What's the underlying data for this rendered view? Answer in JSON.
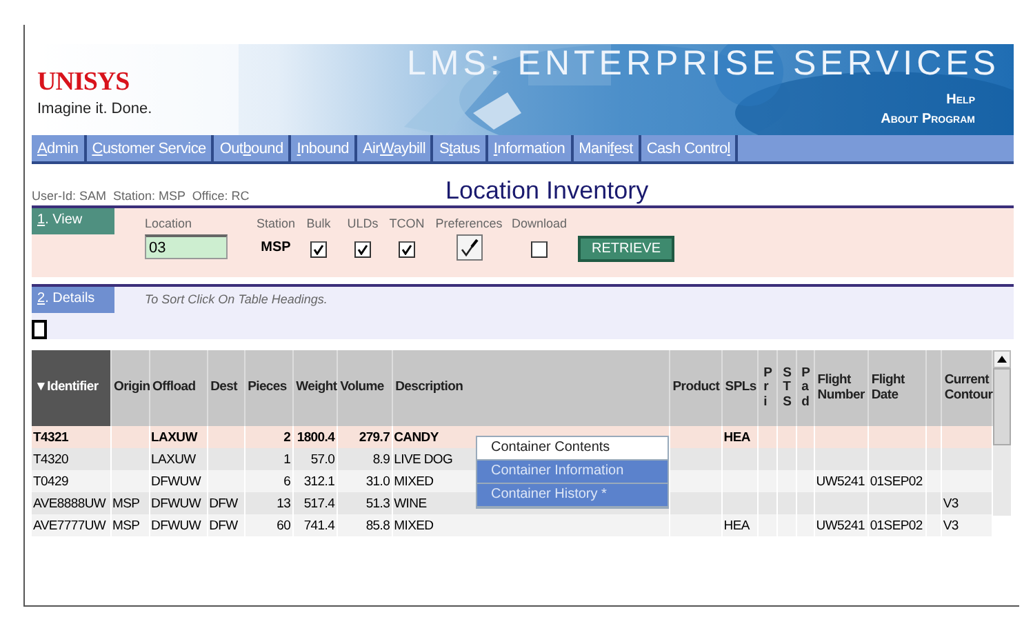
{
  "header": {
    "logo": "UNISYS",
    "tagline": "Imagine it. Done.",
    "title": "LMS: ENTERPRISE SERVICES",
    "links": [
      "Help",
      "About Program"
    ]
  },
  "menu": [
    {
      "key": "A",
      "after": "dmin"
    },
    {
      "key": "C",
      "after": "ustomer Service"
    },
    {
      "before": "Out",
      "key": "b",
      "after": "ound"
    },
    {
      "key": "I",
      "after": "nbound"
    },
    {
      "before": "Air",
      "key": "W",
      "after": "aybill"
    },
    {
      "before": "S",
      "key": "t",
      "after": "atus"
    },
    {
      "key": "I",
      "after": "nformation"
    },
    {
      "before": "Mani",
      "key": "f",
      "after": "est"
    },
    {
      "before": "Cash Contro",
      "key": "l"
    }
  ],
  "user_info": "User-Id: SAM  Station: MSP  Office: RC",
  "page_title": "Location Inventory",
  "view": {
    "tab": {
      "key": "1",
      "after": ". View"
    },
    "location_label": "Location",
    "location_value": "03",
    "station_label": "Station",
    "station_value": "MSP",
    "checks": [
      {
        "label": "Bulk",
        "checked": true
      },
      {
        "label": "ULDs",
        "checked": true
      },
      {
        "label": "TCON",
        "checked": true
      }
    ],
    "preferences_label": "Preferences",
    "download": {
      "label": "Download",
      "checked": false
    },
    "retrieve": "RETRIEVE"
  },
  "details": {
    "tab": {
      "key": "2",
      "after": ". Details"
    },
    "hint": "To Sort Click On Table Headings."
  },
  "table": {
    "columns": [
      {
        "label": "▼Identifier"
      },
      {
        "label": "Origin"
      },
      {
        "label": "Offload"
      },
      {
        "label": "Dest"
      },
      {
        "label": "Pieces",
        "kind": "number"
      },
      {
        "label": "Weight",
        "kind": "number"
      },
      {
        "label": "Volume",
        "kind": "number"
      },
      {
        "label": "Description"
      },
      {
        "label": "Product"
      },
      {
        "label": "SPLs"
      },
      {
        "label": "Pri",
        "kind": "stacked"
      },
      {
        "label": "STS",
        "kind": "stacked"
      },
      {
        "label": "Pad",
        "kind": "stacked"
      },
      {
        "label": "Flight Number"
      },
      {
        "label": "Flight Date"
      },
      {
        "label": "Current Contour"
      }
    ],
    "rows": [
      {
        "selected": true,
        "cells": [
          "T4321",
          null,
          "LAXUW",
          null,
          "2",
          "1800.4",
          "279.7",
          "CANDY",
          null,
          "HEA",
          null,
          null,
          null,
          null,
          null,
          null
        ]
      },
      {
        "selected": false,
        "cells": [
          "T4320",
          null,
          "LAXUW",
          null,
          "1",
          "57.0",
          "8.9",
          "LIVE DOG",
          null,
          null,
          null,
          null,
          null,
          null,
          null,
          null
        ]
      },
      {
        "selected": false,
        "cells": [
          "T0429",
          null,
          "DFWUW",
          null,
          "6",
          "312.1",
          "31.0",
          "MIXED",
          null,
          null,
          null,
          null,
          null,
          "UW5241",
          "01SEP02",
          null
        ]
      },
      {
        "selected": false,
        "cells": [
          "AVE8888UW",
          "MSP",
          "DFWUW",
          "DFW",
          "13",
          "517.4",
          "51.3",
          "WINE",
          null,
          null,
          null,
          null,
          null,
          null,
          null,
          "V3"
        ]
      },
      {
        "selected": false,
        "cells": [
          "AVE7777UW",
          "MSP",
          "DFWUW",
          "DFW",
          "60",
          "741.4",
          "85.8",
          "MIXED",
          null,
          "HEA",
          null,
          null,
          null,
          "UW5241",
          "01SEP02",
          "V3"
        ]
      }
    ]
  },
  "context_menu": [
    {
      "label": "Container Contents",
      "selected": true
    },
    {
      "label": "Container Information",
      "selected": false
    },
    {
      "label": "Container History *",
      "selected": false
    }
  ]
}
